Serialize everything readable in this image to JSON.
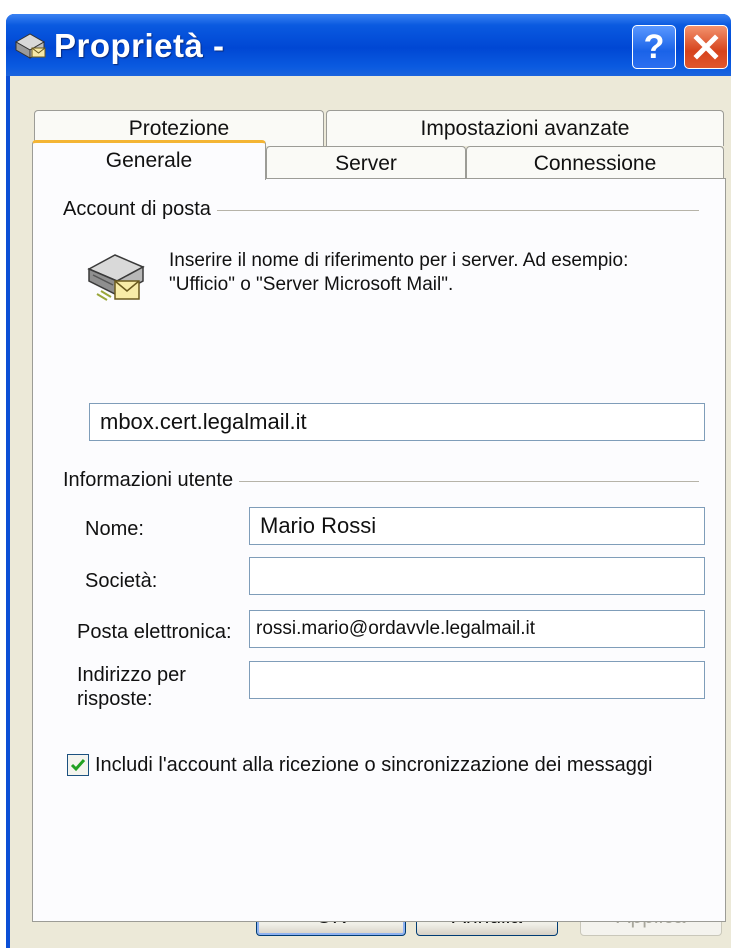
{
  "window": {
    "title": "Proprietà -",
    "help_label": "?",
    "close_label": "✕"
  },
  "tabs": {
    "row1": [
      "Protezione",
      "Impostazioni avanzate"
    ],
    "row2": [
      "Generale",
      "Server",
      "Connessione"
    ],
    "active": "Generale"
  },
  "account_group": {
    "label": "Account di posta",
    "info_line1": "Inserire il nome di riferimento per i server. Ad esempio:",
    "info_line2": "\"Ufficio\" o \"Server Microsoft Mail\".",
    "account_name_value": "mbox.cert.legalmail.it"
  },
  "user_group": {
    "label": "Informazioni utente",
    "name_label": "Nome:",
    "name_value": "Mario Rossi",
    "company_label": "Società:",
    "company_value": "",
    "email_label": "Posta elettronica:",
    "email_value": "rossi.mario@ordavvle.legalmail.it",
    "reply_label_line1": "Indirizzo per",
    "reply_label_line2": "risposte:",
    "reply_value": ""
  },
  "include_checkbox": {
    "label": "Includi l'account alla ricezione o sincronizzazione dei messaggi",
    "checked": true
  },
  "buttons": {
    "ok": "OK",
    "cancel": "Annulla",
    "apply": "Applica"
  }
}
